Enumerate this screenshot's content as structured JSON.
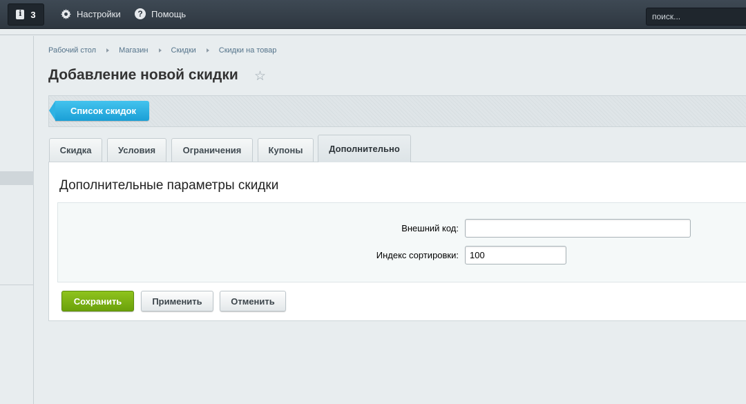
{
  "topbar": {
    "notifications_count": "3",
    "settings_label": "Настройки",
    "help_label": "Помощь",
    "search_placeholder": "поиск..."
  },
  "breadcrumb": [
    "Рабочий стол",
    "Магазин",
    "Скидки",
    "Скидки на товар"
  ],
  "page": {
    "title": "Добавление новой скидки"
  },
  "toolbar": {
    "list_button": "Список скидок"
  },
  "tabs": [
    {
      "label": "Скидка",
      "active": false
    },
    {
      "label": "Условия",
      "active": false
    },
    {
      "label": "Ограничения",
      "active": false
    },
    {
      "label": "Купоны",
      "active": false
    },
    {
      "label": "Дополнительно",
      "active": true
    }
  ],
  "panel": {
    "title": "Дополнительные параметры скидки",
    "fields": {
      "external_code_label": "Внешний код:",
      "external_code_value": "",
      "sort_index_label": "Индекс сортировки:",
      "sort_index_value": "100"
    }
  },
  "buttons": {
    "save": "Сохранить",
    "apply": "Применить",
    "cancel": "Отменить"
  },
  "colors": {
    "accent_blue": "#1b9fd6",
    "save_green": "#6ba10b",
    "topbar_dark": "#2e3740"
  }
}
